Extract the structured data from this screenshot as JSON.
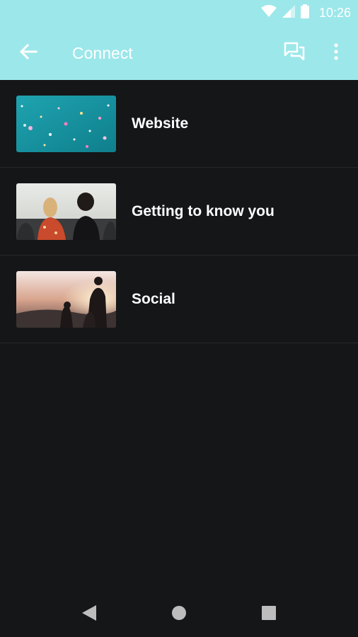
{
  "status_bar": {
    "time": "10:26",
    "icons": [
      "wifi-icon",
      "signal-icon",
      "battery-icon"
    ]
  },
  "app_bar": {
    "title": "Connect",
    "icons": [
      "back-arrow-icon",
      "chat-icon",
      "more-vert-icon"
    ],
    "color": "#9ce7ea"
  },
  "list": {
    "items": [
      {
        "label": "Website",
        "thumbnail": "teal-confetti-image"
      },
      {
        "label": "Getting to know you",
        "thumbnail": "people-gathering-image"
      },
      {
        "label": "Social",
        "thumbnail": "sunset-silhouettes-image"
      }
    ]
  },
  "nav_bar": {
    "icons": [
      "back-triangle-icon",
      "home-circle-icon",
      "recents-square-icon"
    ]
  },
  "colors": {
    "background": "#151618",
    "text": "#ffffff",
    "divider": "#26282b"
  }
}
